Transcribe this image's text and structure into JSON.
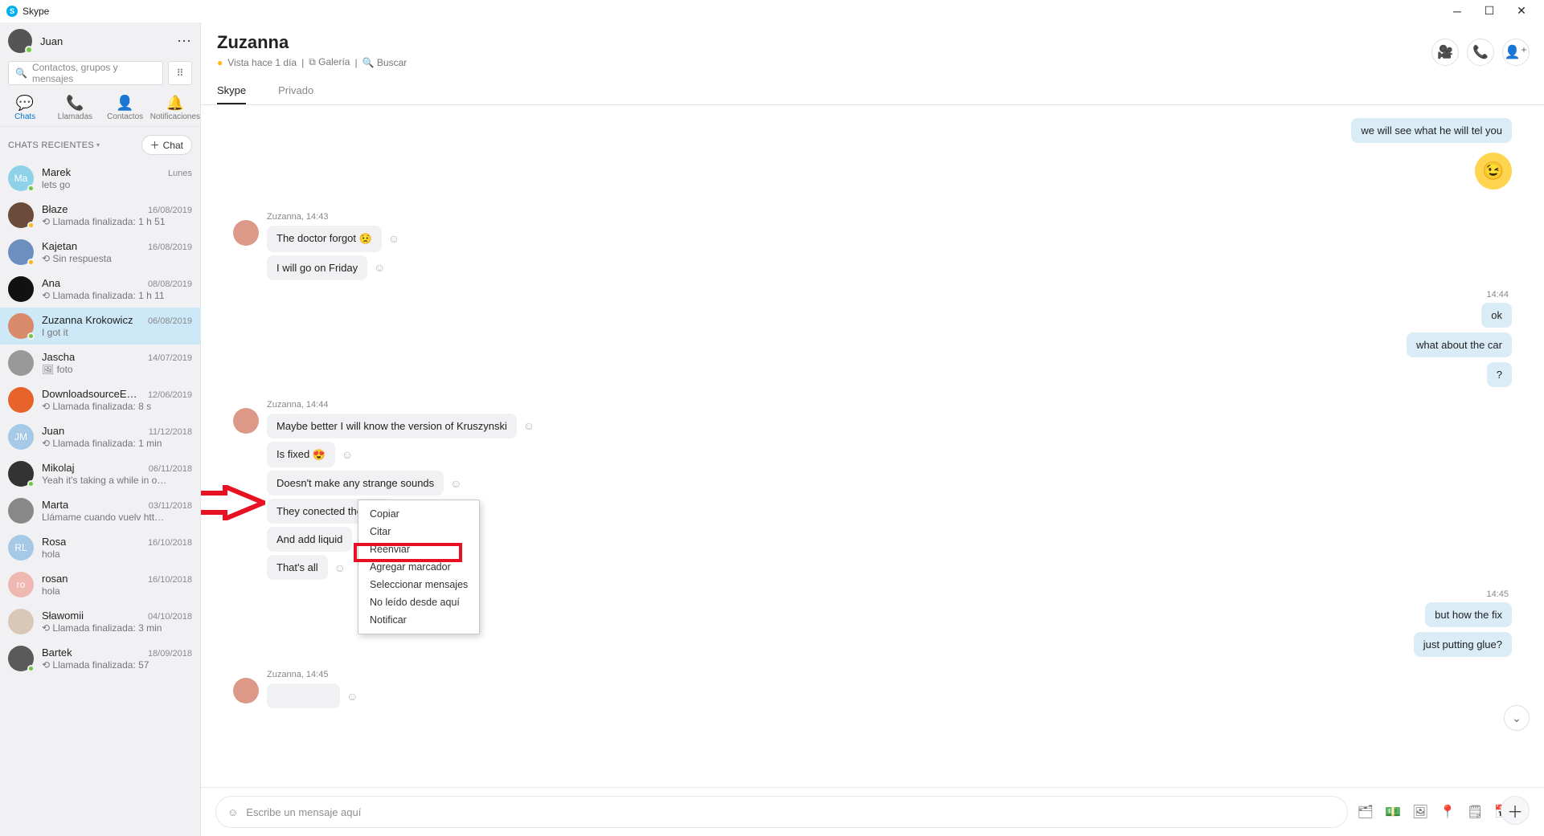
{
  "titlebar": {
    "app_name": "Skype"
  },
  "sidebar": {
    "user_name": "Juan",
    "search_placeholder": "Contactos, grupos y mensajes",
    "tabs": {
      "chats": "Chats",
      "calls": "Llamadas",
      "contacts": "Contactos",
      "notifications": "Notificaciones"
    },
    "recents_label": "CHATS RECIENTES",
    "new_chat_label": "Chat",
    "items": [
      {
        "name": "Marek",
        "preview": "lets go",
        "time": "Lunes",
        "initials": "Ma",
        "color": "#8fd1e6",
        "presence": "online"
      },
      {
        "name": "Błaze",
        "preview": "⟲ Llamada finalizada: 1 h 51",
        "time": "16/08/2019",
        "initials": "",
        "color": "#6b4b3a",
        "presence": "away"
      },
      {
        "name": "Kajetan",
        "preview": "⟲ Sin respuesta",
        "time": "16/08/2019",
        "initials": "",
        "color": "#6d8fbf",
        "presence": "away"
      },
      {
        "name": "Ana",
        "preview": "⟲ Llamada finalizada: 1 h 11",
        "time": "08/08/2019",
        "initials": "",
        "color": "#111",
        "presence": ""
      },
      {
        "name": "Zuzanna Krokowicz",
        "preview": "I got it",
        "time": "06/08/2019",
        "initials": "",
        "color": "#d98a6a",
        "presence": "online"
      },
      {
        "name": "Jascha",
        "preview": "🖼 foto",
        "time": "14/07/2019",
        "initials": "",
        "color": "#999",
        "presence": ""
      },
      {
        "name": "DownloadsourceES España",
        "preview": "⟲ Llamada finalizada: 8 s",
        "time": "12/06/2019",
        "initials": "",
        "color": "#e8622c",
        "presence": ""
      },
      {
        "name": "Juan",
        "preview": "⟲ Llamada finalizada: 1 min",
        "time": "11/12/2018",
        "initials": "JM",
        "color": "#a5c9e6",
        "presence": ""
      },
      {
        "name": "Mikolaj",
        "preview": "Yeah it's taking a while in o…",
        "time": "06/11/2018",
        "initials": "",
        "color": "#333",
        "presence": "online"
      },
      {
        "name": "Marta",
        "preview": "Llámame cuando vuelv htt…",
        "time": "03/11/2018",
        "initials": "",
        "color": "#888",
        "presence": ""
      },
      {
        "name": "Rosa",
        "preview": "hola",
        "time": "16/10/2018",
        "initials": "RL",
        "color": "#a5c9e6",
        "presence": ""
      },
      {
        "name": "rosan",
        "preview": "hola",
        "time": "16/10/2018",
        "initials": "ro",
        "color": "#f0b8b2",
        "presence": ""
      },
      {
        "name": "Sławomii",
        "preview": "⟲ Llamada finalizada: 3 min",
        "time": "04/10/2018",
        "initials": "",
        "color": "#d9c8b7",
        "presence": ""
      },
      {
        "name": "Bartek",
        "preview": "⟲ Llamada finalizada: 57",
        "time": "18/09/2018",
        "initials": "",
        "color": "#5a5a5a",
        "presence": "online"
      }
    ]
  },
  "conversation": {
    "title": "Zuzanna",
    "status": "Vista hace 1 día",
    "gallery_label": "Galería",
    "search_label": "Buscar",
    "tabs": {
      "skype": "Skype",
      "private": "Privado"
    }
  },
  "messages": {
    "out1": "we will see what he will tel you",
    "group1_label": "Zuzanna, 14:43",
    "in1": "The doctor forgot",
    "in2": "I will go on Friday",
    "time_r1": "14:44",
    "out2": "ok",
    "out3": "what about the car",
    "out4": "?",
    "group2_label": "Zuzanna, 14:44",
    "in3": "Maybe better I will know the version of Kruszynski",
    "in4": "Is fixed",
    "in5": "Doesn't make any strange sounds",
    "in6": "They conected the pipe",
    "in7": "And add liquid",
    "in8": "That's all",
    "time_r2": "14:45",
    "out5": "but how the fix",
    "out6": "just putting glue?",
    "group3_label": "Zuzanna, 14:45"
  },
  "context_menu": {
    "items": [
      "Copiar",
      "Citar",
      "Reenviar",
      "Agregar marcador",
      "Seleccionar mensajes",
      "No leído desde aquí",
      "Notificar"
    ]
  },
  "composer": {
    "placeholder": "Escribe un mensaje aquí"
  }
}
